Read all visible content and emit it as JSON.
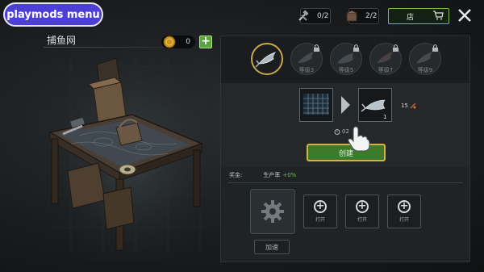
{
  "mod_badge": {
    "label": "playmods menu"
  },
  "top_bar": {
    "tools": {
      "value": "0/2",
      "icon": "hammer-wrench-icon"
    },
    "crates": {
      "value": "2/2",
      "icon": "crate-icon"
    },
    "shop": {
      "label": "店",
      "icon": "cart-icon"
    },
    "close": {
      "icon": "close-icon"
    }
  },
  "station": {
    "title": "捕鱼网",
    "coins": "0",
    "add_icon": "plus-icon",
    "image": "crafting-table-illustration"
  },
  "recipes": {
    "slots": [
      {
        "level": "",
        "icon": "fish-icon",
        "locked": false,
        "active": true
      },
      {
        "level": "等级3",
        "icon": "fish-icon",
        "locked": true,
        "active": false
      },
      {
        "level": "等级5",
        "icon": "fish-icon",
        "locked": true,
        "active": false
      },
      {
        "level": "等级7",
        "icon": "fish-icon",
        "locked": true,
        "active": false
      },
      {
        "level": "等级9",
        "icon": "fish-icon",
        "locked": true,
        "active": false
      }
    ]
  },
  "craft": {
    "input_icon": "net-icon",
    "output_icon": "fish-icon",
    "output_qty": "1",
    "stock": "15",
    "timer": "02",
    "create_label": "创建"
  },
  "stats": {
    "label": "奖金:",
    "rate_label": "生产率",
    "rate_value": "+0%"
  },
  "production": {
    "gear_icon": "gear-icon",
    "speed_label": "加速",
    "open_slots": [
      {
        "label": "打开"
      },
      {
        "label": "打开"
      },
      {
        "label": "打开"
      }
    ]
  },
  "colors": {
    "accent_gold": "#d6b14b",
    "create_green": "#3c7a2c",
    "mod_purple": "#4d3fd6",
    "positive": "#6fbf4a"
  }
}
